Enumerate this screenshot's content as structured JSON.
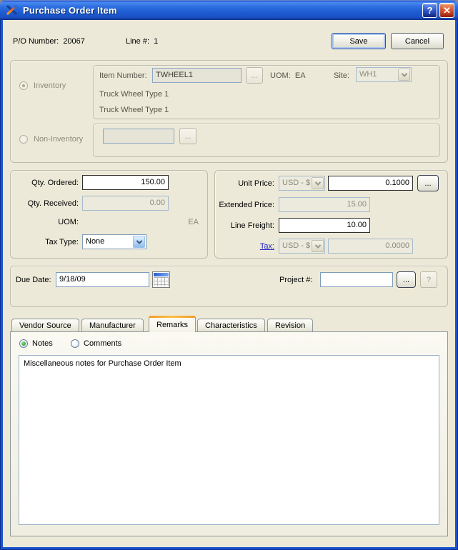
{
  "window": {
    "title": "Purchase Order Item",
    "help_label": "?",
    "close_label": "✕"
  },
  "header": {
    "po_label": "P/O Number:",
    "po_value": "20067",
    "line_label": "Line #:",
    "line_value": "1",
    "save_label": "Save",
    "cancel_label": "Cancel"
  },
  "item": {
    "inventory_label": "Inventory",
    "non_inventory_label": "Non-Inventory",
    "item_number_label": "Item Number:",
    "item_number_value": "TWHEEL1",
    "item_browse_label": "...",
    "uom_label": "UOM:",
    "uom_value": "EA",
    "site_label": "Site:",
    "site_value": "WH1",
    "description_line1": "Truck Wheel Type 1",
    "description_line2": "Truck Wheel Type 1",
    "non_inventory_value": "",
    "non_inventory_browse_label": "..."
  },
  "quantities": {
    "qty_ordered_label": "Qty. Ordered:",
    "qty_ordered_value": "150.00",
    "qty_received_label": "Qty. Received:",
    "qty_received_value": "0.00",
    "uom_label": "UOM:",
    "uom_value": "EA",
    "tax_type_label": "Tax Type:",
    "tax_type_value": "None"
  },
  "pricing": {
    "unit_price_label": "Unit Price:",
    "unit_price_currency": "USD - $",
    "unit_price_value": "0.1000",
    "price_browse_label": "...",
    "extended_price_label": "Extended Price:",
    "extended_price_value": "15.00",
    "line_freight_label": "Line Freight:",
    "line_freight_value": "10.00",
    "tax_label": "Tax:",
    "tax_currency": "USD - $",
    "tax_value": "0.0000"
  },
  "schedule": {
    "due_date_label": "Due Date:",
    "due_date_value": "9/18/09",
    "project_label": "Project #:",
    "project_value": "",
    "project_browse_label": "...",
    "project_help_label": "?"
  },
  "tabs": [
    "Vendor Source",
    "Manufacturer",
    "Remarks",
    "Characteristics",
    "Revision"
  ],
  "remarks": {
    "notes_label": "Notes",
    "comments_label": "Comments",
    "notes_text": "Miscellaneous notes for Purchase Order Item"
  },
  "colors": {
    "titlebar_blue": "#1e55d3",
    "frame_blue": "#1c52cd",
    "dialog_bg": "#ece9d8",
    "active_tab_accent": "#f0a12d",
    "link_blue": "#2222cc",
    "radio_selected_green": "#2da02d",
    "close_button_red": "#dd5430"
  }
}
